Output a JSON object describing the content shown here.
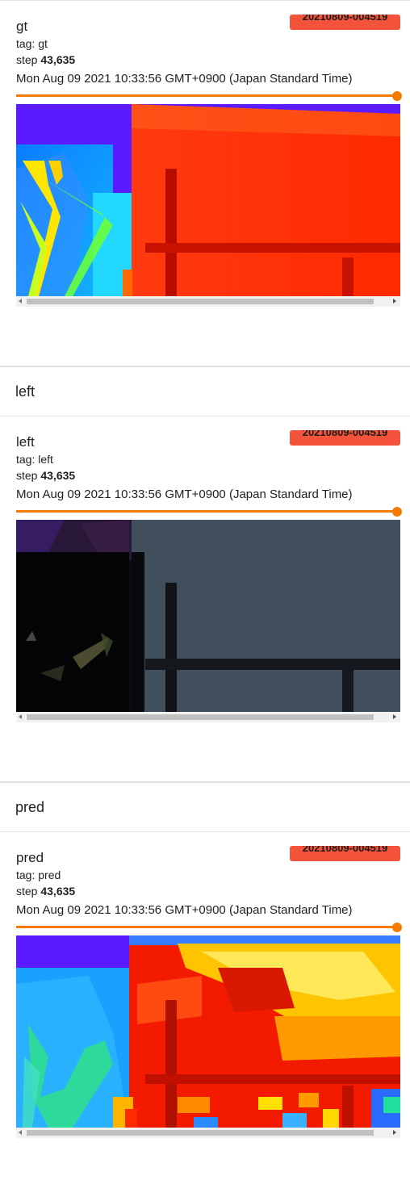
{
  "cards": [
    {
      "title": "gt",
      "run_badge": "20210809-004519",
      "tag_label": "tag: gt",
      "step_label": "step",
      "step_value": "43,635",
      "timestamp": "Mon Aug 09 2021 10:33:56 GMT+0900 (Japan Standard Time)",
      "image_kind": "depth-ground-truth"
    },
    {
      "title": "left",
      "run_badge": "20210809-004519",
      "tag_label": "tag: left",
      "step_label": "step",
      "step_value": "43,635",
      "timestamp": "Mon Aug 09 2021 10:33:56 GMT+0900 (Japan Standard Time)",
      "image_kind": "left-camera"
    },
    {
      "title": "pred",
      "run_badge": "20210809-004519",
      "tag_label": "tag: pred",
      "step_label": "step",
      "step_value": "43,635",
      "timestamp": "Mon Aug 09 2021 10:33:56 GMT+0900 (Japan Standard Time)",
      "image_kind": "depth-prediction"
    }
  ],
  "sections": [
    {
      "label": "left"
    },
    {
      "label": "pred"
    }
  ],
  "colors": {
    "accent": "#f57c00",
    "badge": "#f4533b"
  }
}
